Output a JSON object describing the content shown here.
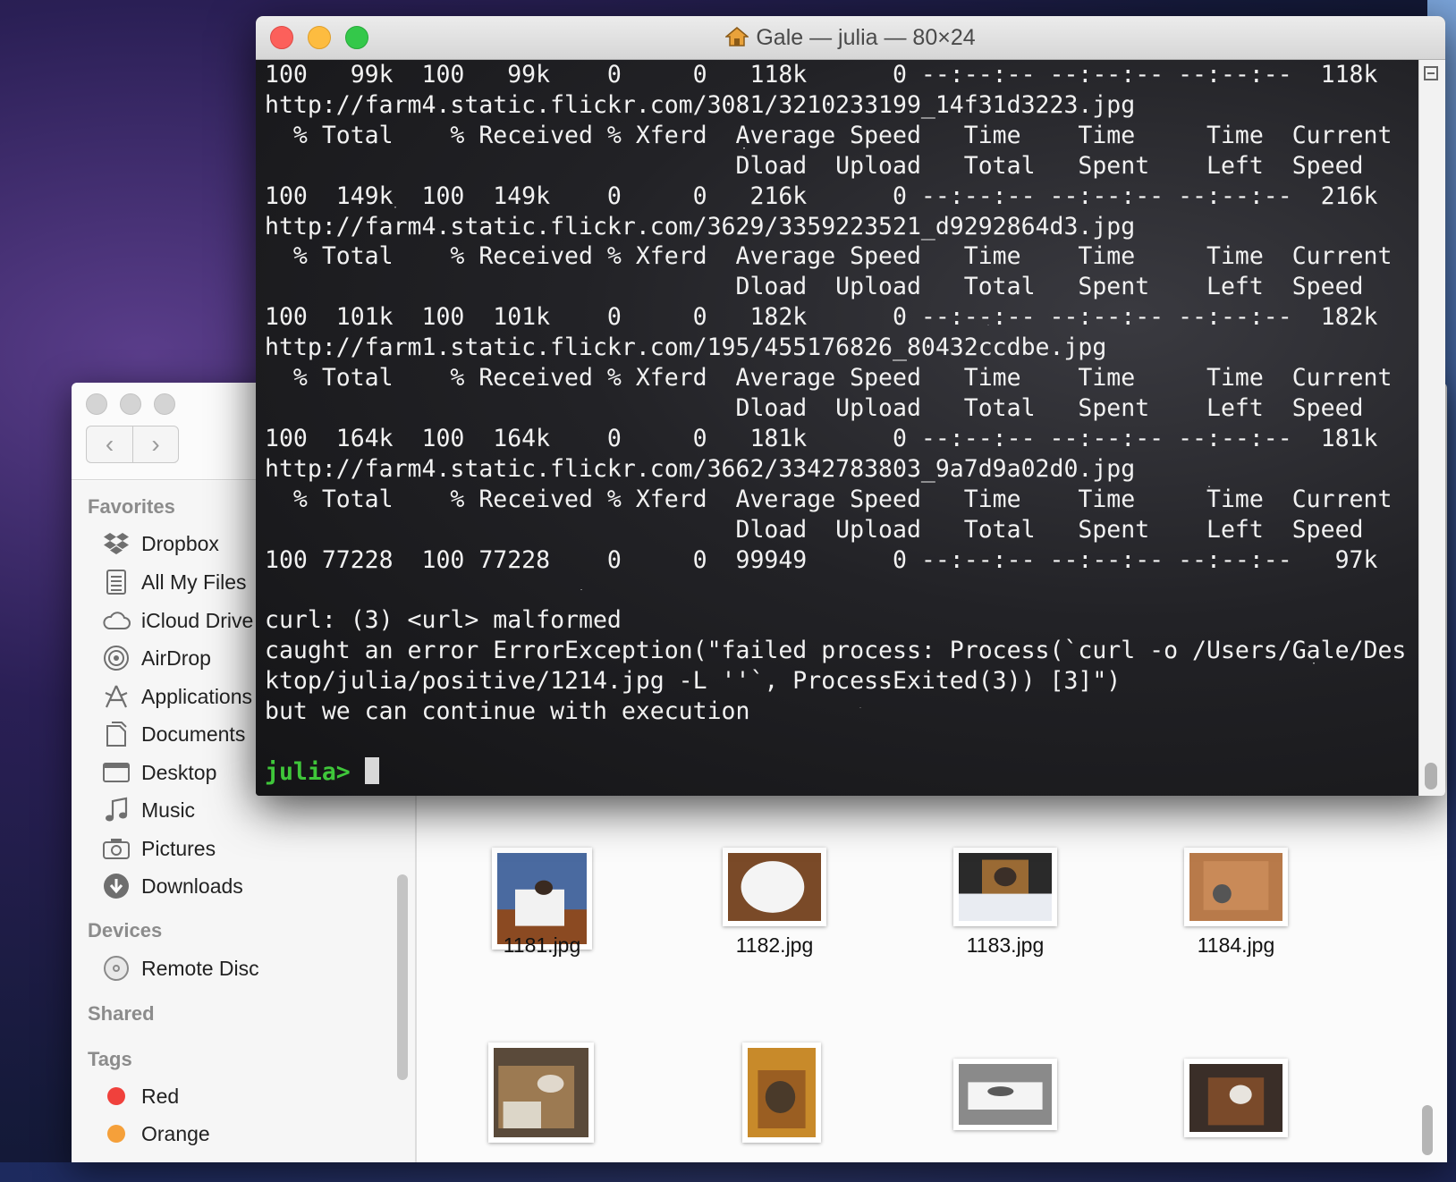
{
  "terminal": {
    "title": "Gale — julia — 80×24",
    "lines": [
      "100   99k  100   99k    0     0   118k      0 --:--:-- --:--:-- --:--:--  118k",
      "http://farm4.static.flickr.com/3081/3210233199_14f31d3223.jpg",
      "  % Total    % Received % Xferd  Average Speed   Time    Time     Time  Current",
      "                                 Dload  Upload   Total   Spent    Left  Speed",
      "100  149k  100  149k    0     0   216k      0 --:--:-- --:--:-- --:--:--  216k",
      "http://farm4.static.flickr.com/3629/3359223521_d9292864d3.jpg",
      "  % Total    % Received % Xferd  Average Speed   Time    Time     Time  Current",
      "                                 Dload  Upload   Total   Spent    Left  Speed",
      "100  101k  100  101k    0     0   182k      0 --:--:-- --:--:-- --:--:--  182k",
      "http://farm1.static.flickr.com/195/455176826_80432ccdbe.jpg",
      "  % Total    % Received % Xferd  Average Speed   Time    Time     Time  Current",
      "                                 Dload  Upload   Total   Spent    Left  Speed",
      "100  164k  100  164k    0     0   181k      0 --:--:-- --:--:-- --:--:--  181k",
      "http://farm4.static.flickr.com/3662/3342783803_9a7d9a02d0.jpg",
      "  % Total    % Received % Xferd  Average Speed   Time    Time     Time  Current",
      "                                 Dload  Upload   Total   Spent    Left  Speed",
      "100 77228  100 77228    0     0  99949      0 --:--:-- --:--:-- --:--:--   97k",
      "",
      "curl: (3) <url> malformed",
      "caught an error ErrorException(\"failed process: Process(`curl -o /Users/Gale/Des",
      "ktop/julia/positive/1214.jpg -L ''`, ProcessExited(3)) [3]\")",
      "but we can continue with execution",
      ""
    ],
    "prompt": "julia>",
    "prompt_color": "#3fc63a"
  },
  "finder": {
    "sections": {
      "favorites": "Favorites",
      "devices": "Devices",
      "shared": "Shared",
      "tags": "Tags"
    },
    "favorites": [
      {
        "label": "Dropbox",
        "icon": "dropbox-icon"
      },
      {
        "label": "All My Files",
        "icon": "all-my-files-icon"
      },
      {
        "label": "iCloud Drive",
        "icon": "icloud-icon"
      },
      {
        "label": "AirDrop",
        "icon": "airdrop-icon"
      },
      {
        "label": "Applications",
        "icon": "applications-icon"
      },
      {
        "label": "Documents",
        "icon": "documents-icon"
      },
      {
        "label": "Desktop",
        "icon": "desktop-icon"
      },
      {
        "label": "Music",
        "icon": "music-icon"
      },
      {
        "label": "Pictures",
        "icon": "pictures-icon"
      },
      {
        "label": "Downloads",
        "icon": "downloads-icon"
      }
    ],
    "devices": [
      {
        "label": "Remote Disc",
        "icon": "remote-disc-icon"
      }
    ],
    "tags": [
      {
        "label": "Red",
        "color": "#f0413c"
      },
      {
        "label": "Orange",
        "color": "#f5a03a"
      }
    ],
    "files": [
      "1181.jpg",
      "1182.jpg",
      "1183.jpg",
      "1184.jpg"
    ]
  }
}
